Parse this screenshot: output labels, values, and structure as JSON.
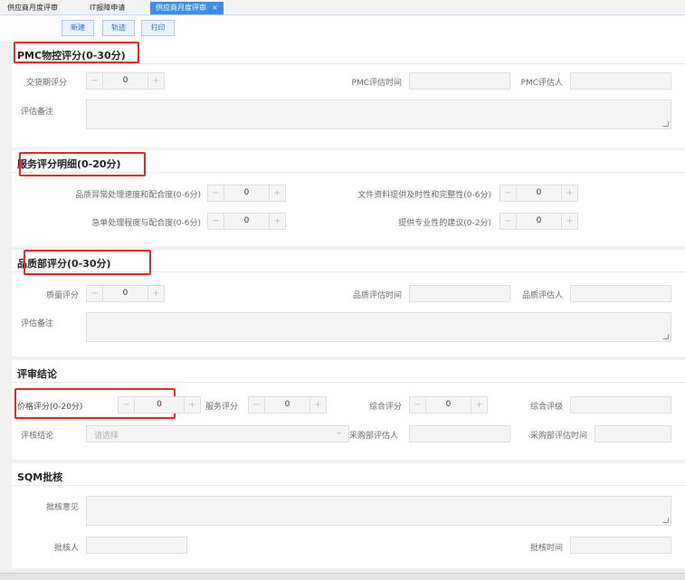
{
  "tabs": [
    {
      "label": "供应商月度评审"
    },
    {
      "label": "IT报障申请"
    },
    {
      "label": "供应商月度评审",
      "close": "×"
    }
  ],
  "toolbar": {
    "new": "新建",
    "track": "轨迹",
    "print": "打印"
  },
  "pmc": {
    "title": "PMC物控评分(0-30分)",
    "delivery_label": "交货期评分",
    "delivery_value": "0",
    "eval_time_label": "PMC评估时间",
    "evaluator_label": "PMC评估人",
    "remark_label": "评估备注"
  },
  "service": {
    "title": "服务评分明细(0-20分)",
    "q1_label": "品质异常处理速度和配合度(0-6分)",
    "q1_value": "0",
    "q2_label": "文件资料提供及时性和完整性(0-6分)",
    "q2_value": "0",
    "q3_label": "急单处理程度与配合度(0-6分)",
    "q3_value": "0",
    "q4_label": "提供专业性的建议(0-2分)",
    "q4_value": "0"
  },
  "quality": {
    "title": "品质部评分(0-30分)",
    "score_label": "质量评分",
    "score_value": "0",
    "eval_time_label": "品质评估时间",
    "evaluator_label": "品质评估人",
    "remark_label": "评估备注"
  },
  "conclusion": {
    "title": "评审结论",
    "price_label": "价格评分(0-20分)",
    "price_value": "0",
    "service_label": "服务评分",
    "service_value": "0",
    "total_label": "综合评分",
    "total_value": "0",
    "grade_label": "综合评级",
    "result_label": "评核结论",
    "result_placeholder": "请选择",
    "buyer_label": "采购部评估人",
    "buyer_time_label": "采购部评估时间"
  },
  "sqm": {
    "title": "SQM批核",
    "opinion_label": "批核意见",
    "approver_label": "批核人",
    "time_label": "批核时间"
  },
  "icons": {
    "minus": "−",
    "plus": "+",
    "chevron": "⌄"
  },
  "colors": {
    "accent": "#3d8ee6",
    "highlight": "#e52626"
  }
}
